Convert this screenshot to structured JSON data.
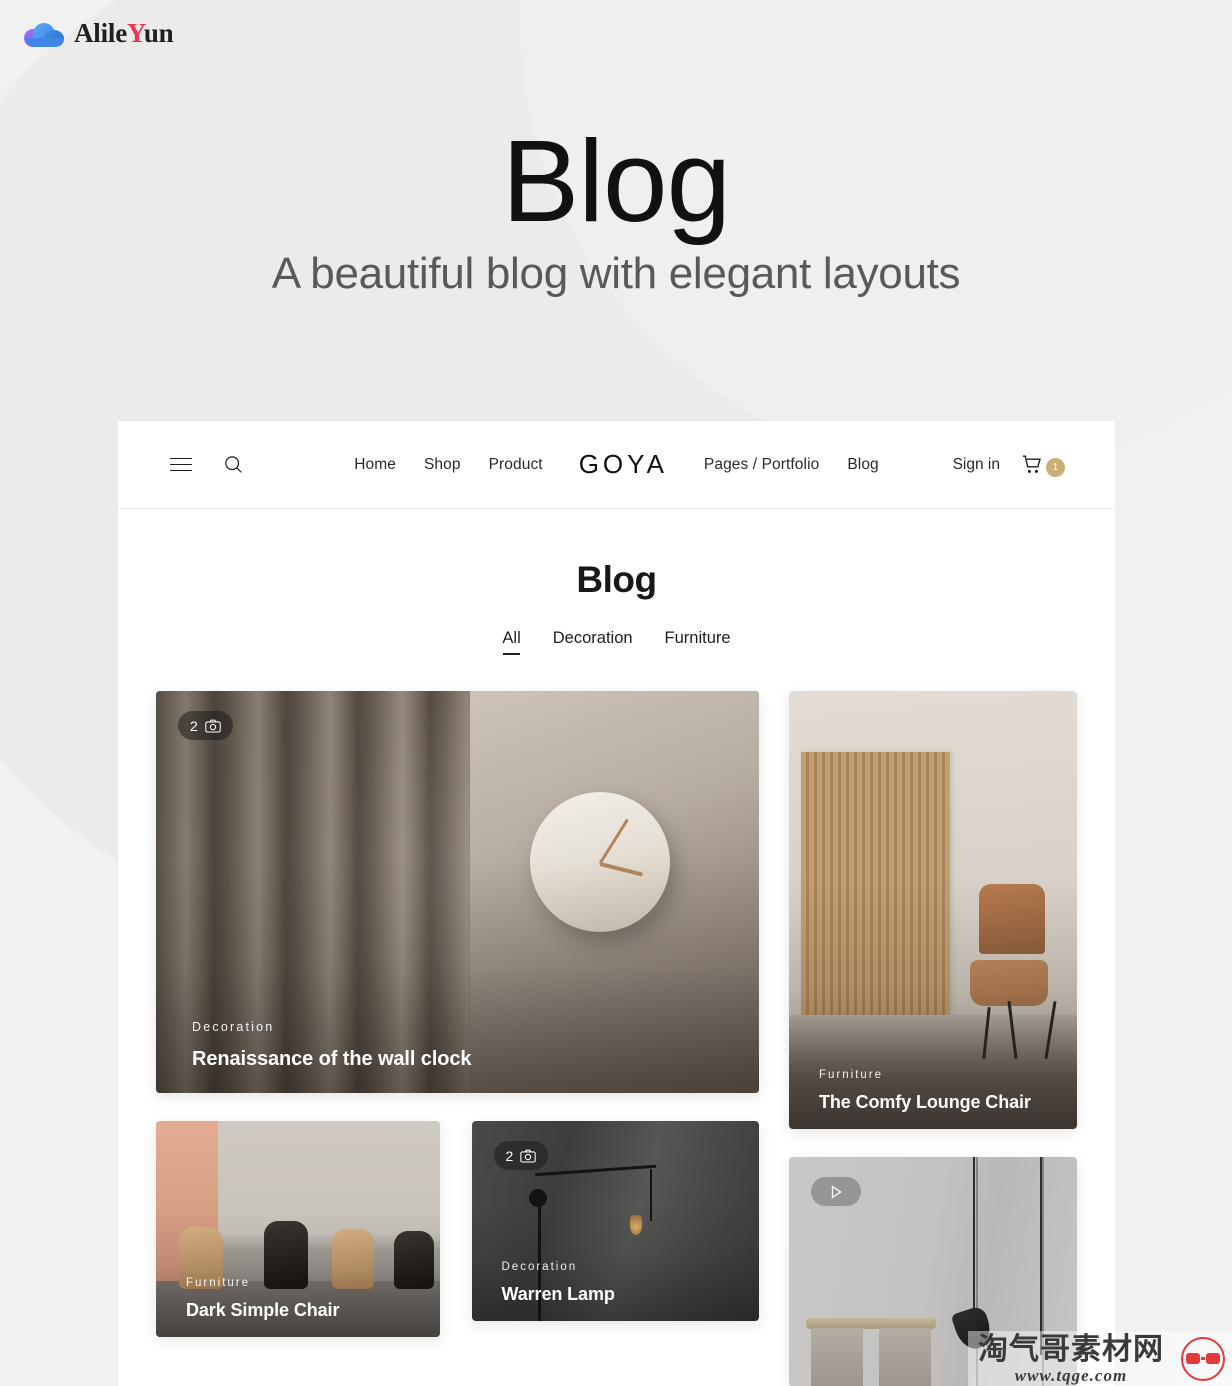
{
  "brand": {
    "name_prefix": "Alile",
    "name_highlight": "Y",
    "name_suffix": "un",
    "icon": "cloud-icon"
  },
  "hero": {
    "title": "Blog",
    "subtitle": "A beautiful blog with elegant layouts"
  },
  "header": {
    "menu_icon": "hamburger-menu-icon",
    "search_icon": "search-icon",
    "logo": "GOYA",
    "nav_links": [
      {
        "label": "Home"
      },
      {
        "label": "Shop"
      },
      {
        "label": "Product"
      }
    ],
    "nav_links_right": [
      {
        "label": "Pages / Portfolio"
      },
      {
        "label": "Blog"
      }
    ],
    "sign_in": "Sign in",
    "cart_icon": "shopping-cart-icon",
    "cart_count": "1",
    "cart_badge_color": "#c9ae75"
  },
  "blog": {
    "title": "Blog",
    "filters": [
      {
        "label": "All",
        "active": true
      },
      {
        "label": "Decoration",
        "active": false
      },
      {
        "label": "Furniture",
        "active": false
      }
    ],
    "posts": [
      {
        "id": "wall-clock",
        "category": "Decoration",
        "title": "Renaissance of the wall clock",
        "badge_type": "photo",
        "badge_count": "2",
        "badge_icon": "camera-icon"
      },
      {
        "id": "lounge-chair",
        "category": "Furniture",
        "title": "The Comfy Lounge Chair",
        "badge_type": "none",
        "badge_count": "",
        "badge_icon": ""
      },
      {
        "id": "dark-simple-chair",
        "category": "Furniture",
        "title": "Dark Simple Chair",
        "badge_type": "none",
        "badge_count": "",
        "badge_icon": ""
      },
      {
        "id": "warren-lamp",
        "category": "Decoration",
        "title": "Warren Lamp",
        "badge_type": "photo",
        "badge_count": "2",
        "badge_icon": "camera-icon"
      },
      {
        "id": "video-post",
        "category": "",
        "title": "",
        "badge_type": "video",
        "badge_count": "",
        "badge_icon": "play-icon"
      }
    ]
  },
  "watermark": {
    "cn_text": "淘气哥素材网",
    "url": "www.tqge.com",
    "logo_icon": "glasses-icon",
    "logo_color": "#e23a3a"
  }
}
